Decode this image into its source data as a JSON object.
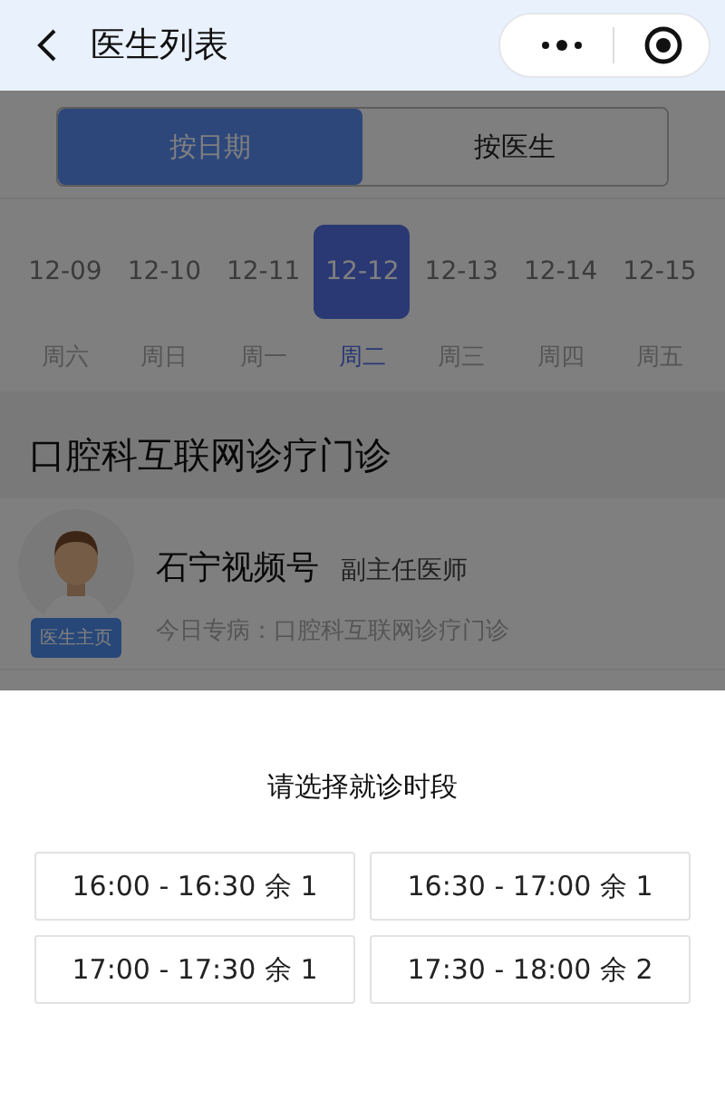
{
  "nav": {
    "title": "医生列表"
  },
  "view_toggle": [
    {
      "label": "按日期",
      "selected": true
    },
    {
      "label": "按医生",
      "selected": false
    }
  ],
  "dates": [
    {
      "date": "12-09",
      "weekday": "周六",
      "selected": false
    },
    {
      "date": "12-10",
      "weekday": "周日",
      "selected": false
    },
    {
      "date": "12-11",
      "weekday": "周一",
      "selected": false
    },
    {
      "date": "12-12",
      "weekday": "周二",
      "selected": true
    },
    {
      "date": "12-13",
      "weekday": "周三",
      "selected": false
    },
    {
      "date": "12-14",
      "weekday": "周四",
      "selected": false
    },
    {
      "date": "12-15",
      "weekday": "周五",
      "selected": false
    }
  ],
  "department": {
    "title": "口腔科互联网诊疗门诊"
  },
  "doctors": [
    {
      "name": "石宁视频号",
      "title": "副主任医师",
      "specialty": "今日专病：口腔科互联网诊疗门诊",
      "profile_button": "医生主页"
    }
  ],
  "time_sheet": {
    "title": "请选择就诊时段",
    "slots": [
      {
        "label": "16:00 - 16:30 余 1"
      },
      {
        "label": "16:30 - 17:00 余 1"
      },
      {
        "label": "17:00 - 17:30 余 1"
      },
      {
        "label": "17:30 - 18:00 余 2"
      }
    ]
  }
}
